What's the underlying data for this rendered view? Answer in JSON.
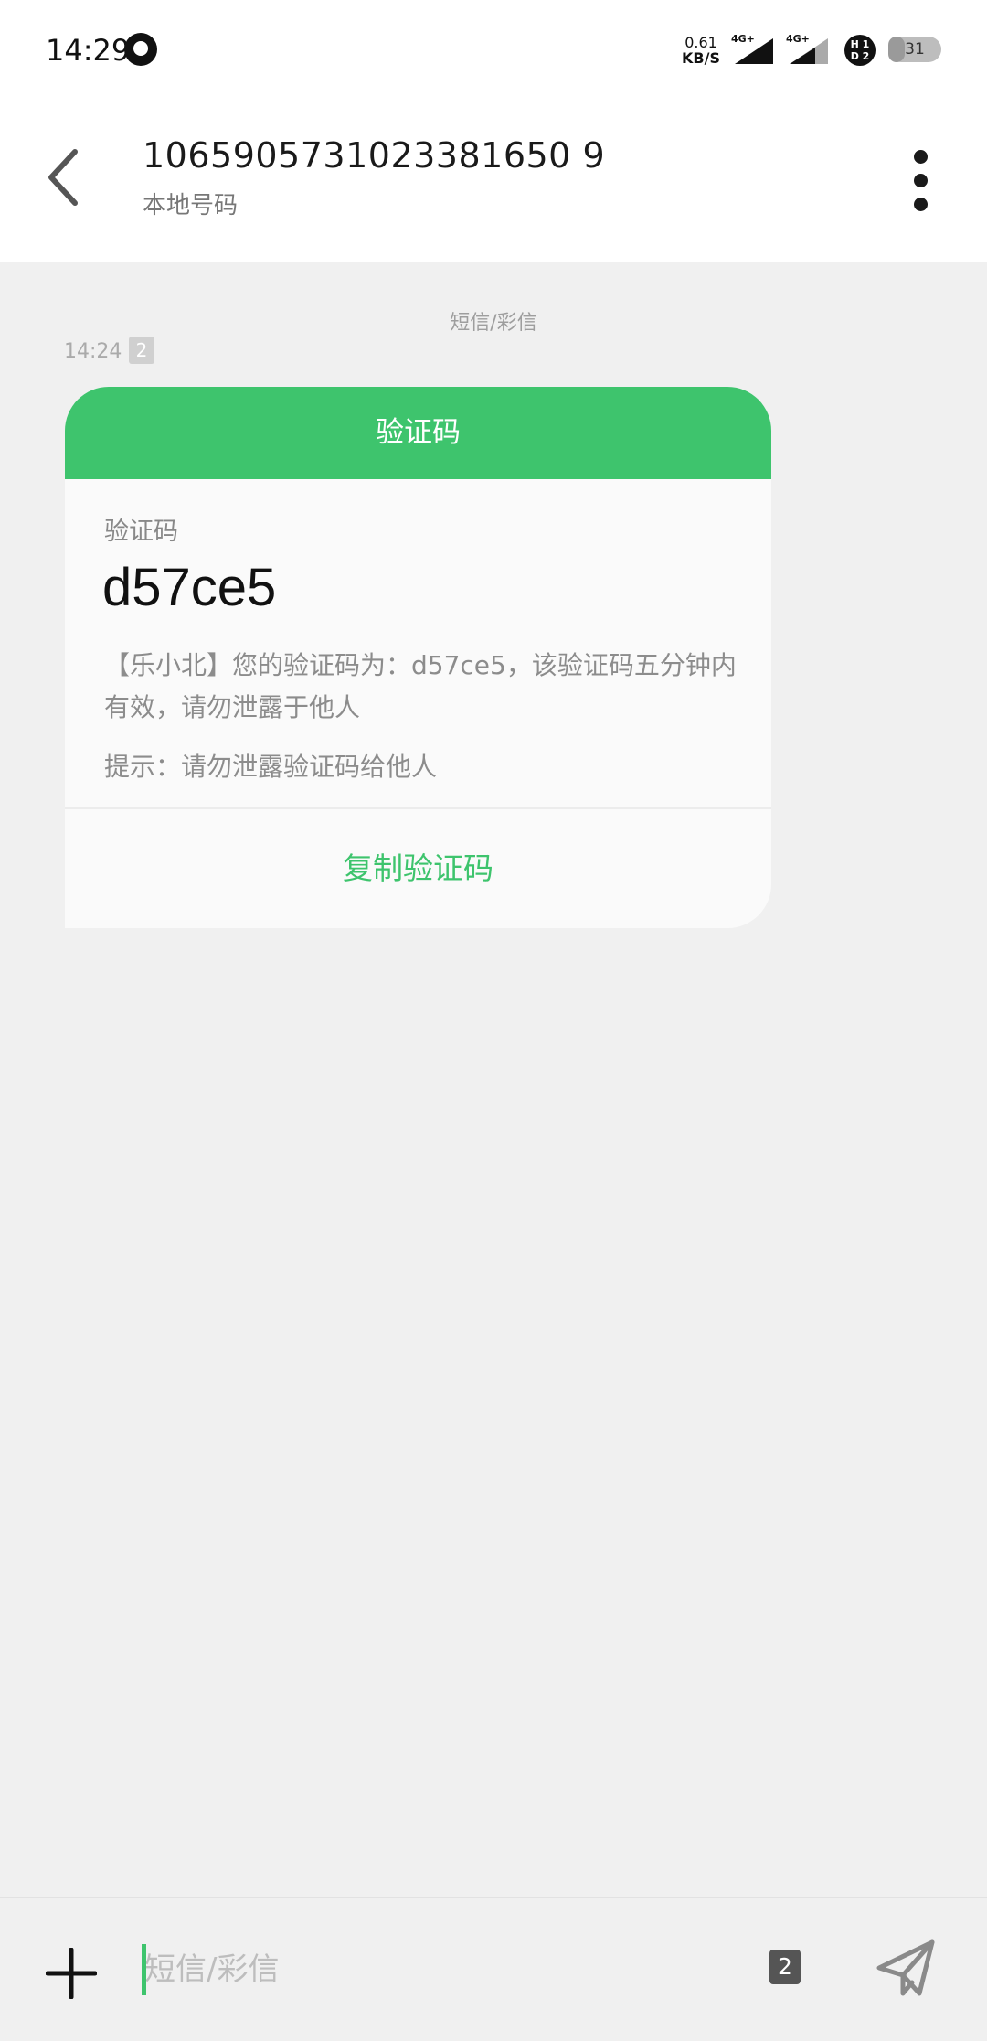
{
  "status_bar": {
    "time": "14:29",
    "net_speed_value": "0.61",
    "net_speed_unit": "KB/S",
    "signal1": "4G+",
    "signal2": "4G+",
    "hd_top": "H 1",
    "hd_bottom": "D 2",
    "battery": "31",
    "battery_level": 0.31
  },
  "header": {
    "number": "1065905731023381650 9",
    "subtitle": "本地号码"
  },
  "conversation": {
    "label": "短信/彩信",
    "message_time": "14:24",
    "sim": "2"
  },
  "card": {
    "title": "验证码",
    "code_label": "验证码",
    "code": "d57ce5",
    "body": "【乐小北】您的验证码为：d57ce5，该验证码五分钟内有效，请勿泄露于他人",
    "hint": "提示：请勿泄露验证码给他人",
    "copy_label": "复制验证码"
  },
  "compose": {
    "placeholder": "短信/彩信",
    "sim": "2"
  },
  "colors": {
    "accent": "#3ec46d",
    "background": "#f0f0f0",
    "card_background": "#fafafa"
  },
  "icons": {
    "back": "chevron-left-icon",
    "more": "more-vertical-icon",
    "add": "plus-icon",
    "send": "send-icon"
  }
}
